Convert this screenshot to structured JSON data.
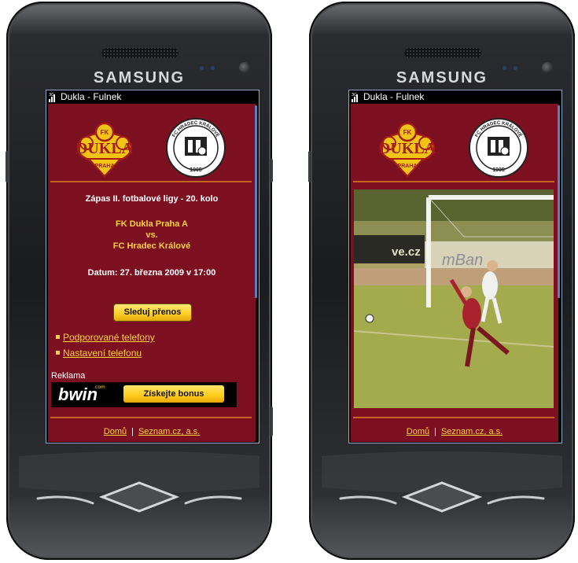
{
  "brand": "SAMSUNG",
  "status_title": "Dukla - Fulnek",
  "logos": {
    "dukla_main": "DUKLA",
    "dukla_top": "FK",
    "dukla_bottom": "PRAHA",
    "hradec_ring": "FC HRADEC KRÁLOVÉ",
    "hradec_year": "1905"
  },
  "match": {
    "heading": "Zápas II. fotbalové ligy - 20. kolo",
    "home": "FK Dukla Praha A",
    "vs": "vs.",
    "away": "FC Hradec Králové",
    "datetime": "Datum: 27. března 2009 v 17:00"
  },
  "follow_button": "Sleduj přenos",
  "links": [
    "Podporované telefony",
    "Nastavení telefonu"
  ],
  "ad": {
    "label": "Reklama",
    "brand": "bwin",
    "brand_suffix": ".com",
    "button": "Získejte bonus"
  },
  "footer": {
    "home": "Domů",
    "separator": "|",
    "company": "Seznam.cz, a.s."
  },
  "video": {
    "board_text_1": "ve.cz",
    "board_text_2": "mBan"
  },
  "colors": {
    "page_bg": "#7c1020",
    "accent_yellow": "#ffd23a",
    "rule_orange": "#c2661e",
    "scrollbar_blue": "#5b7fb8"
  },
  "icons": [
    "signal-3g-icon",
    "home-key-icon",
    "call-key-icon",
    "end-key-icon"
  ]
}
